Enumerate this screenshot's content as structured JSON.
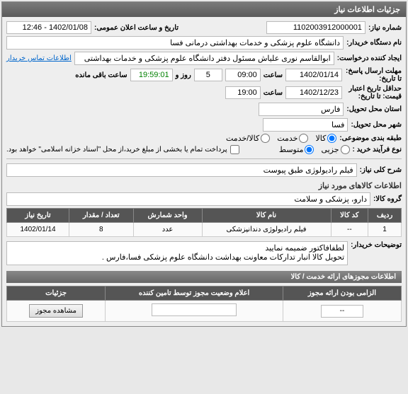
{
  "header": {
    "title": "جزئیات اطلاعات نیاز"
  },
  "fields": {
    "needNo_label": "شماره نیاز:",
    "needNo": "1102003912000001",
    "announceDate_label": "تاریخ و ساعت اعلان عمومی:",
    "announceDate": "1402/01/08 - 12:46",
    "buyerOrg_label": "نام دستگاه خریدار:",
    "buyerOrg": "دانشگاه علوم پزشکی و خدمات بهداشتی درمانی فسا",
    "requester_label": "ایجاد کننده درخواست:",
    "requester": "ابوالقاسم نوری علیاش مسئول دفتر دانشگاه علوم پزشکی و خدمات بهداشتی",
    "contactLink": "اطلاعات تماس خریدار",
    "replyDeadline_label": "مهلت ارسال پاسخ: تا تاریخ:",
    "replyDate": "1402/01/14",
    "time_label": "ساعت",
    "replyTime": "09:00",
    "daysLeft": "5",
    "and_label": "روز و",
    "remaining": "19:59:01",
    "remaining_suffix": "ساعت باقی مانده",
    "minValidity_label": "حداقل تاریخ اعتبار قیمت: تا تاریخ:",
    "validityDate": "1402/12/23",
    "validityTime": "19:00",
    "province_label": "استان محل تحویل:",
    "province": "فارس",
    "city_label": "شهر محل تحویل:",
    "city": "فسا",
    "category_label": "طبقه بندی موضوعی:",
    "cat_opts": {
      "kala": "کالا",
      "khadmat": "خدمت",
      "both": "کالا/خدمت"
    },
    "process_label": "نوع فرآیند خرید :",
    "proc_opts": {
      "small": "جزیی",
      "medium": "متوسط"
    },
    "paymentNote": "پرداخت تمام یا بخشی از مبلغ خرید،از محل \"اسناد خزانه اسلامی\" خواهد بود.",
    "descTitle_label": "شرح کلی نیاز:",
    "descTitle": "فیلم رادیولوژی طبق پیوست",
    "itemsHeader": "اطلاعات کالاهای مورد نیاز",
    "group_label": "گروه کالا:",
    "group": "دارو، پزشکی و سلامت",
    "buyerNotes_label": "توضیحات خریدار:",
    "buyerNotes": "لطفافاکتور ضمیمه نمایید\nتحویل کالا انبار تدارکات معاونت بهداشت دانشگاه علوم پزشکی فسا،فارس .",
    "licHeader": "اطلاعات مجوزهای ارائه خدمت / کالا"
  },
  "itemsTable": {
    "headers": [
      "ردیف",
      "کد کالا",
      "نام کالا",
      "واحد شمارش",
      "تعداد / مقدار",
      "تاریخ نیاز"
    ],
    "rows": [
      {
        "idx": "1",
        "code": "--",
        "name": "فیلم رادیولوژی دندانپزشکی",
        "unit": "عدد",
        "qty": "8",
        "date": "1402/01/14"
      }
    ]
  },
  "licTable": {
    "headers": [
      "الزامی بودن ارائه مجوز",
      "اعلام وضعیت مجوز توسط تامین کننده",
      "جزئیات"
    ],
    "rows": [
      {
        "mandatory": "--",
        "status": "",
        "detailBtn": "مشاهده مجوز"
      }
    ]
  }
}
